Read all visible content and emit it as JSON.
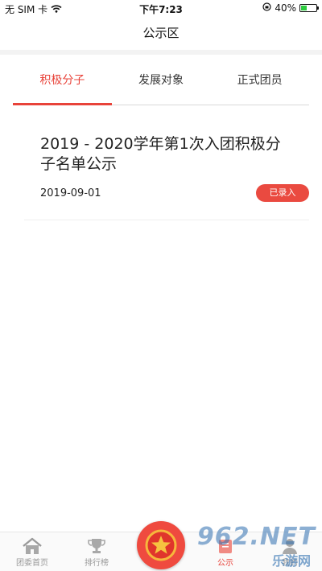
{
  "status_bar": {
    "carrier": "无 SIM 卡",
    "time": "下午7:23",
    "battery_percent": "40%",
    "battery_level": 0.4
  },
  "nav": {
    "title": "公示区"
  },
  "tabs": [
    {
      "label": "积极分子",
      "active": true
    },
    {
      "label": "发展对象",
      "active": false
    },
    {
      "label": "正式团员",
      "active": false
    }
  ],
  "notices": [
    {
      "title": "2019 - 2020学年第1次入团积极分子名单公示",
      "date": "2019-09-01",
      "badge": "已录入"
    }
  ],
  "tabbar": {
    "items": [
      {
        "label": "团委首页",
        "icon": "home-icon"
      },
      {
        "label": "排行榜",
        "icon": "trophy-icon"
      },
      {
        "label": "公示",
        "icon": "notice-icon"
      },
      {
        "label": "我的",
        "icon": "user-icon"
      }
    ],
    "center_icon": "star-icon"
  },
  "watermark": {
    "text": "962.NET",
    "subtext": "乐游网"
  },
  "colors": {
    "accent": "#e8433a",
    "badge": "#ea4a40",
    "center_button": "#ef4a3f"
  }
}
